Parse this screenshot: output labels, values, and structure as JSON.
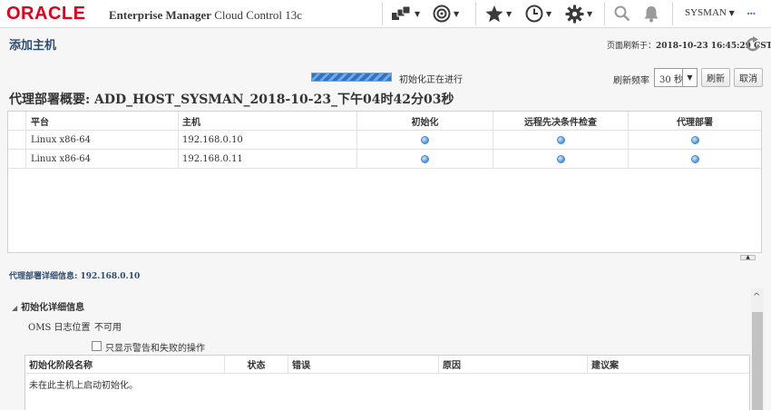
{
  "header": {
    "logo": "ORACLE",
    "product_bold": "Enterprise Manager",
    "product_rest": " Cloud Control 13c",
    "user": "SYSMAN",
    "icons": [
      "targets-icon",
      "favorites-target-icon",
      "star-icon",
      "history-clock-icon",
      "gear-icon",
      "search-icon",
      "bell-icon",
      "more-icon"
    ]
  },
  "page": {
    "title": "添加主机",
    "refresh_label": "页面刷新于：",
    "refresh_time": "2018-10-23 16:45:29 CST"
  },
  "progress": {
    "label": "初始化正在进行"
  },
  "controls": {
    "rate_label": "刷新频率",
    "rate_value": "30 秒",
    "refresh_button": "刷新",
    "cancel_button": "取消"
  },
  "summary": {
    "title": "代理部署概要: ADD_HOST_SYSMAN_2018-10-23_下午04时42分03秒"
  },
  "hosts_table": {
    "columns": [
      "平台",
      "主机",
      "初始化",
      "远程先决条件检查",
      "代理部署"
    ],
    "rows": [
      {
        "platform": "Linux x86-64",
        "host": "192.168.0.10",
        "init": "in-progress",
        "prereq": "in-progress",
        "deploy": "in-progress"
      },
      {
        "platform": "Linux x86-64",
        "host": "192.168.0.11",
        "init": "in-progress",
        "prereq": "in-progress",
        "deploy": "in-progress"
      }
    ]
  },
  "details": {
    "host_label": "代理部署详细信息: 192.168.0.10",
    "section_title": "初始化详细信息",
    "oms_label": "OMS 日志位置",
    "oms_value": "不可用",
    "checkbox_label": "只显示警告和失败的操作",
    "stage_columns": [
      "初始化阶段名称",
      "状态",
      "错误",
      "原因",
      "建议案"
    ],
    "empty_message": "未在此主机上启动初始化。"
  },
  "colors": {
    "oracle_red": "#e2001a",
    "title_blue": "#2d4d72",
    "status_dot": "#5c9fe0",
    "progress_bar": "#2f73c4"
  }
}
